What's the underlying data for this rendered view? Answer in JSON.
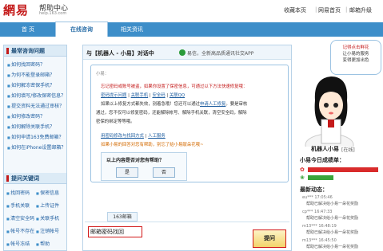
{
  "header": {
    "logo": "網易",
    "subtitle": "帮助中心",
    "url": "help.163.com",
    "links": [
      "收藏本页",
      "网易首页",
      "邮箱升级"
    ]
  },
  "nav": {
    "tabs": [
      "首 页",
      "在线咨询",
      "相关资讯"
    ]
  },
  "sidebar": {
    "faq_title": "最常咨询问题",
    "faq": [
      "如何找回密码？",
      "为何不能登录邮箱？",
      "如何解冻密保手机？",
      "如何填写/修改保密信息？",
      "提交资料无法通过审核？",
      "如何修改密码？",
      "如何解除关联手机？",
      "如何申请163免费邮箱？",
      "如何在iPhone设置邮箱？"
    ],
    "keywords_title": "提问关键词",
    "keywords": [
      [
        "找回密码",
        "保密信息"
      ],
      [
        "手机关联",
        "上传证件"
      ],
      [
        "清空安全码",
        "关联手机"
      ],
      [
        "帐号不存在",
        "注销帐号"
      ],
      [
        "帐号冻结",
        "帮助"
      ]
    ]
  },
  "chat": {
    "title": "与【机器人 - 小易】对话中",
    "app_ad": "易信，全新高品质通讯社交APP",
    "speaker": "小易：",
    "lines": [
      [
        "忘记密码或账号被盗，如果你设置了保密信息，可通过以下方法快速修复哦："
      ],
      [
        "密码提示问题",
        "关联手机",
        "安全码",
        "关联QQ"
      ],
      [
        "如果以上修复方式都失效，别着急哦！您还可以通过",
        "申请人工修复",
        "。要是审核"
      ],
      [
        "通过，您不仅可以修复密码，还能解除帐号、解除手机关联，清空安全码，解除"
      ],
      [
        "密保的绑定等等哦。"
      ],
      [
        "用密码修改与找回方式",
        "人工服务"
      ],
      [
        "如果小易的回答对您有帮助，别忘了给小易献朵花哦~"
      ]
    ],
    "feedback_q": "以上内容是否对您有帮助？",
    "yes": "是",
    "no": "否",
    "mail_tab": "163邮箱",
    "input_value": "邮箱密码找回",
    "ask_button": "提问"
  },
  "right": {
    "speech": [
      "记得点击鲜花",
      "让小易的服务",
      "变得更加出色"
    ],
    "robot_name": "机器人小易",
    "robot_status": "[在线]",
    "flower_title": "小易今日成绩单：",
    "latest_title": "最新动态：",
    "activities": [
      [
        "eu***   17:05:46",
        "帮助已解决给小易一朵花奖励"
      ],
      [
        "cp***   16:47:33",
        "帮助已解决给小易一朵花奖励"
      ],
      [
        "m13***   16:48:19",
        "帮助已解决给小易一朵花奖励"
      ],
      [
        "m13***   16:45:50",
        "帮助已解决给小易一朵花奖励"
      ]
    ]
  },
  "colors": {
    "brand_red": "#c41a1a",
    "nav_blue": "#3d8ec9",
    "highlight_red": "#d21818"
  }
}
